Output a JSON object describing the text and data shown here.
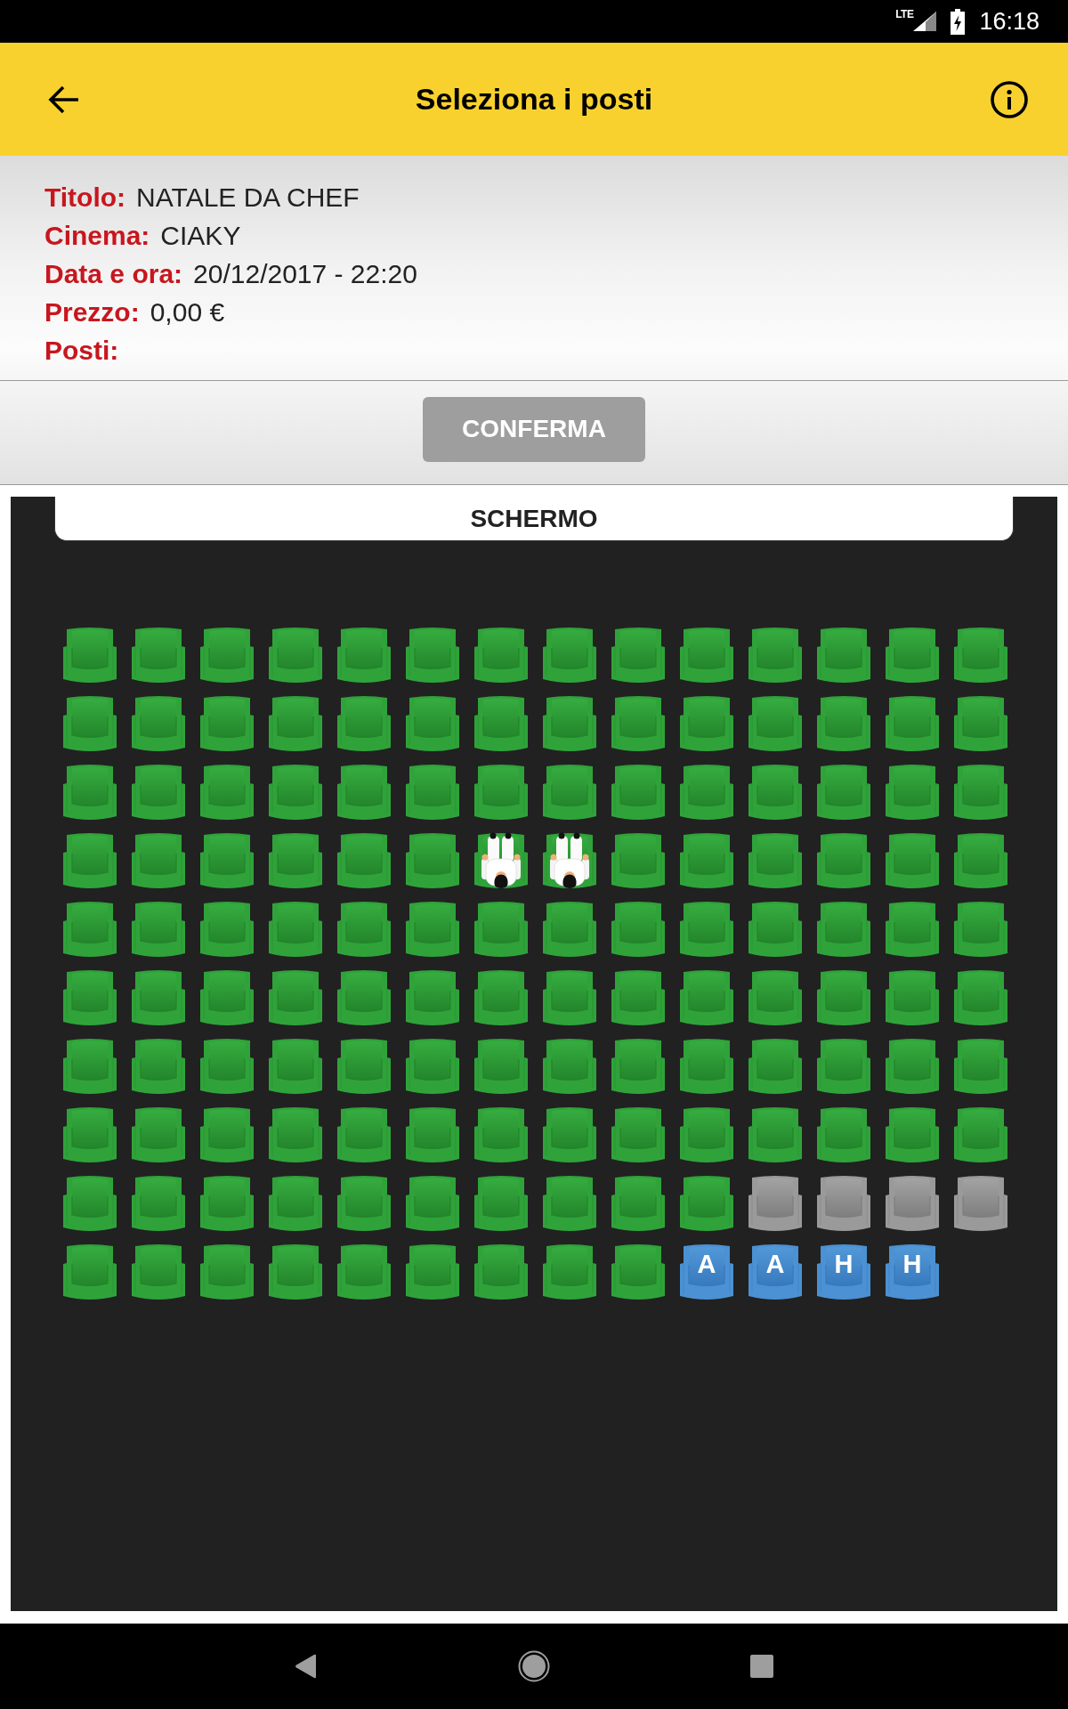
{
  "status_bar": {
    "network": "LTE",
    "time": "16:18"
  },
  "app_bar": {
    "title": "Seleziona i posti"
  },
  "details": [
    {
      "label": "Titolo:",
      "value": "NATALE DA CHEF"
    },
    {
      "label": "Cinema:",
      "value": "CIAKY"
    },
    {
      "label": "Data e ora:",
      "value": "20/12/2017 - 22:20"
    },
    {
      "label": "Prezzo:",
      "value": "0,00 €"
    },
    {
      "label": "Posti:"
    }
  ],
  "confirm_button": {
    "label": "CONFERMA",
    "disabled": true
  },
  "screen": {
    "label": "SCHERMO"
  },
  "seat_rows": [
    {
      "seats": [
        {
          "kind": "free"
        },
        {
          "kind": "free"
        },
        {
          "kind": "free"
        },
        {
          "kind": "free"
        },
        {
          "kind": "free"
        },
        {
          "kind": "free"
        },
        {
          "kind": "free"
        },
        {
          "kind": "free"
        },
        {
          "kind": "free"
        },
        {
          "kind": "free"
        },
        {
          "kind": "free"
        },
        {
          "kind": "free"
        },
        {
          "kind": "free"
        },
        {
          "kind": "free"
        }
      ]
    },
    {
      "seats": [
        {
          "kind": "free"
        },
        {
          "kind": "free"
        },
        {
          "kind": "free"
        },
        {
          "kind": "free"
        },
        {
          "kind": "free"
        },
        {
          "kind": "free"
        },
        {
          "kind": "free"
        },
        {
          "kind": "free"
        },
        {
          "kind": "free"
        },
        {
          "kind": "free"
        },
        {
          "kind": "free"
        },
        {
          "kind": "free"
        },
        {
          "kind": "free"
        },
        {
          "kind": "free"
        }
      ]
    },
    {
      "seats": [
        {
          "kind": "free"
        },
        {
          "kind": "free"
        },
        {
          "kind": "free"
        },
        {
          "kind": "free"
        },
        {
          "kind": "free"
        },
        {
          "kind": "free"
        },
        {
          "kind": "free"
        },
        {
          "kind": "free"
        },
        {
          "kind": "free"
        },
        {
          "kind": "free"
        },
        {
          "kind": "free"
        },
        {
          "kind": "free"
        },
        {
          "kind": "free"
        },
        {
          "kind": "free"
        }
      ]
    },
    {
      "seats": [
        {
          "kind": "free"
        },
        {
          "kind": "free"
        },
        {
          "kind": "free"
        },
        {
          "kind": "free"
        },
        {
          "kind": "free"
        },
        {
          "kind": "free"
        },
        {
          "kind": "occupied"
        },
        {
          "kind": "occupied"
        },
        {
          "kind": "free"
        },
        {
          "kind": "free"
        },
        {
          "kind": "free"
        },
        {
          "kind": "free"
        },
        {
          "kind": "free"
        },
        {
          "kind": "free"
        }
      ]
    },
    {
      "seats": [
        {
          "kind": "free"
        },
        {
          "kind": "free"
        },
        {
          "kind": "free"
        },
        {
          "kind": "free"
        },
        {
          "kind": "free"
        },
        {
          "kind": "free"
        },
        {
          "kind": "free"
        },
        {
          "kind": "free"
        },
        {
          "kind": "free"
        },
        {
          "kind": "free"
        },
        {
          "kind": "free"
        },
        {
          "kind": "free"
        },
        {
          "kind": "free"
        },
        {
          "kind": "free"
        }
      ]
    },
    {
      "seats": [
        {
          "kind": "free"
        },
        {
          "kind": "free"
        },
        {
          "kind": "free"
        },
        {
          "kind": "free"
        },
        {
          "kind": "free"
        },
        {
          "kind": "free"
        },
        {
          "kind": "free"
        },
        {
          "kind": "free"
        },
        {
          "kind": "free"
        },
        {
          "kind": "free"
        },
        {
          "kind": "free"
        },
        {
          "kind": "free"
        },
        {
          "kind": "free"
        },
        {
          "kind": "free"
        }
      ]
    },
    {
      "seats": [
        {
          "kind": "free"
        },
        {
          "kind": "free"
        },
        {
          "kind": "free"
        },
        {
          "kind": "free"
        },
        {
          "kind": "free"
        },
        {
          "kind": "free"
        },
        {
          "kind": "free"
        },
        {
          "kind": "free"
        },
        {
          "kind": "free"
        },
        {
          "kind": "free"
        },
        {
          "kind": "free"
        },
        {
          "kind": "free"
        },
        {
          "kind": "free"
        },
        {
          "kind": "free"
        }
      ]
    },
    {
      "seats": [
        {
          "kind": "free"
        },
        {
          "kind": "free"
        },
        {
          "kind": "free"
        },
        {
          "kind": "free"
        },
        {
          "kind": "free"
        },
        {
          "kind": "free"
        },
        {
          "kind": "free"
        },
        {
          "kind": "free"
        },
        {
          "kind": "free"
        },
        {
          "kind": "free"
        },
        {
          "kind": "free"
        },
        {
          "kind": "free"
        },
        {
          "kind": "free"
        },
        {
          "kind": "free"
        }
      ]
    },
    {
      "seats": [
        {
          "kind": "free"
        },
        {
          "kind": "free"
        },
        {
          "kind": "free"
        },
        {
          "kind": "free"
        },
        {
          "kind": "free"
        },
        {
          "kind": "free"
        },
        {
          "kind": "free"
        },
        {
          "kind": "free"
        },
        {
          "kind": "free"
        },
        {
          "kind": "free"
        },
        {
          "kind": "unavailable"
        },
        {
          "kind": "unavailable"
        },
        {
          "kind": "unavailable"
        },
        {
          "kind": "unavailable"
        }
      ]
    },
    {
      "seats": [
        {
          "kind": "free"
        },
        {
          "kind": "free"
        },
        {
          "kind": "free"
        },
        {
          "kind": "free"
        },
        {
          "kind": "free"
        },
        {
          "kind": "free"
        },
        {
          "kind": "free"
        },
        {
          "kind": "free"
        },
        {
          "kind": "free"
        },
        {
          "kind": "special",
          "label": "A"
        },
        {
          "kind": "special",
          "label": "A"
        },
        {
          "kind": "special",
          "label": "H"
        },
        {
          "kind": "special",
          "label": "H"
        }
      ]
    }
  ]
}
